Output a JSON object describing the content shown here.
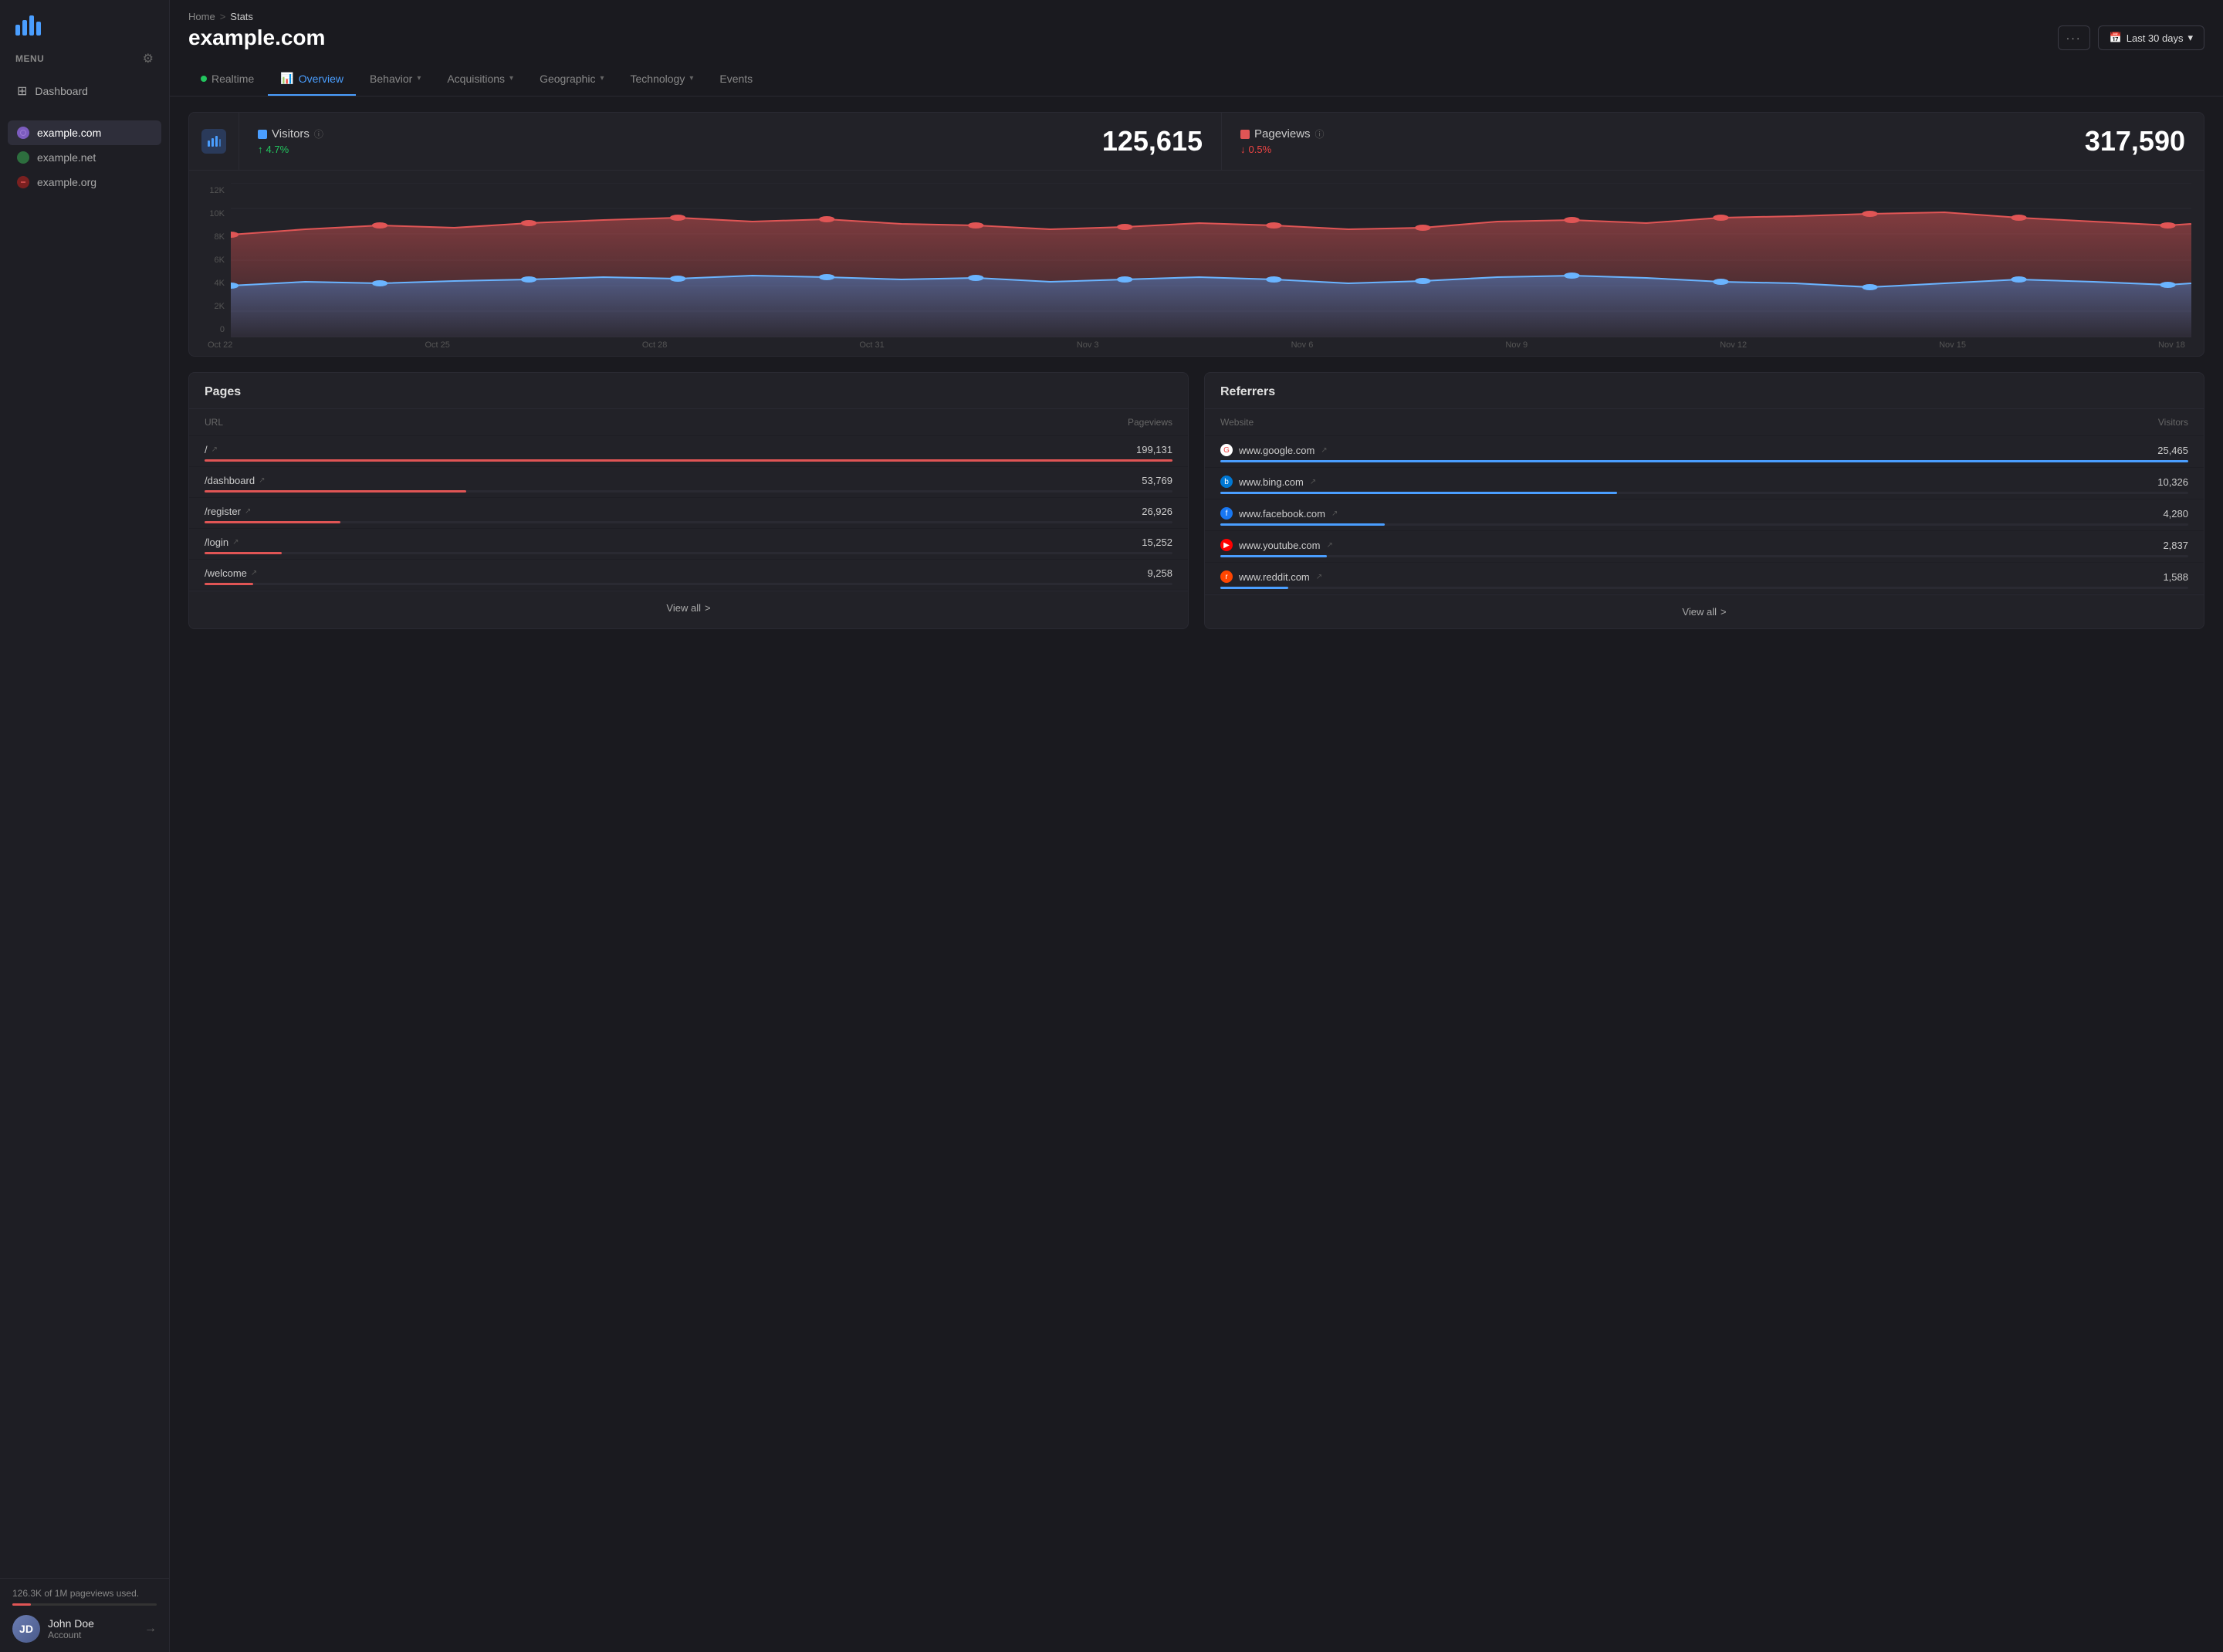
{
  "sidebar": {
    "logo_alt": "Analytics Logo",
    "menu_label": "MENU",
    "settings_icon": "⚙",
    "nav_items": [
      {
        "id": "dashboard",
        "icon": "⊞",
        "label": "Dashboard"
      }
    ],
    "sites": [
      {
        "id": "example-com",
        "label": "example.com",
        "dot_class": "dot-purple",
        "active": true
      },
      {
        "id": "example-net",
        "label": "example.net",
        "dot_class": "dot-green",
        "active": false
      },
      {
        "id": "example-org",
        "label": "example.org",
        "dot_class": "dot-red",
        "active": false
      }
    ],
    "usage_text": "126.3K of 1M pageviews used.",
    "user": {
      "name": "John Doe",
      "account": "Account",
      "initials": "JD"
    },
    "logout_icon": "→"
  },
  "header": {
    "breadcrumb_home": "Home",
    "breadcrumb_sep": ">",
    "breadcrumb_current": "Stats",
    "page_title": "example.com",
    "more_icon": "···",
    "date_icon": "📅",
    "date_label": "Last 30 days",
    "date_chevron": "▾"
  },
  "tabs": [
    {
      "id": "realtime",
      "label": "Realtime",
      "type": "dot"
    },
    {
      "id": "overview",
      "label": "Overview",
      "icon": "📊",
      "active": true
    },
    {
      "id": "behavior",
      "label": "Behavior",
      "icon": "≡",
      "chevron": "▾"
    },
    {
      "id": "acquisitions",
      "label": "Acquisitions",
      "icon": "✦",
      "chevron": "▾"
    },
    {
      "id": "geographic",
      "label": "Geographic",
      "icon": "⊞",
      "chevron": "▾"
    },
    {
      "id": "technology",
      "label": "Technology",
      "icon": "◫",
      "chevron": "▾"
    },
    {
      "id": "events",
      "label": "Events",
      "icon": "⊕"
    }
  ],
  "metrics": {
    "chart_icon": "📊",
    "visitors": {
      "label": "Visitors",
      "color": "#4a9eff",
      "change": "4.7%",
      "change_dir": "up",
      "change_icon": "↑",
      "value": "125,615"
    },
    "pageviews": {
      "label": "Pageviews",
      "color": "#e05555",
      "change": "0.5%",
      "change_dir": "down",
      "change_icon": "↓",
      "value": "317,590"
    }
  },
  "chart": {
    "y_labels": [
      "12K",
      "10K",
      "8K",
      "6K",
      "4K",
      "2K",
      "0"
    ],
    "x_labels": [
      "Oct 22",
      "Oct 25",
      "Oct 28",
      "Oct 31",
      "Nov 3",
      "Nov 6",
      "Nov 9",
      "Nov 12",
      "Nov 15",
      "Nov 18"
    ]
  },
  "pages": {
    "title": "Pages",
    "col_url": "URL",
    "col_pageviews": "Pageviews",
    "rows": [
      {
        "url": "/",
        "value": "199,131",
        "pct": 100
      },
      {
        "url": "/dashboard",
        "value": "53,769",
        "pct": 27
      },
      {
        "url": "/register",
        "value": "26,926",
        "pct": 14
      },
      {
        "url": "/login",
        "value": "15,252",
        "pct": 8
      },
      {
        "url": "/welcome",
        "value": "9,258",
        "pct": 5
      }
    ],
    "view_all": "View all",
    "view_all_arrow": ">"
  },
  "referrers": {
    "title": "Referrers",
    "col_website": "Website",
    "col_visitors": "Visitors",
    "rows": [
      {
        "site": "www.google.com",
        "value": "25,465",
        "pct": 100,
        "fav_class": "fav-google",
        "fav_text": "G"
      },
      {
        "site": "www.bing.com",
        "value": "10,326",
        "pct": 41,
        "fav_class": "fav-bing",
        "fav_text": "b"
      },
      {
        "site": "www.facebook.com",
        "value": "4,280",
        "pct": 17,
        "fav_class": "fav-facebook",
        "fav_text": "f"
      },
      {
        "site": "www.youtube.com",
        "value": "2,837",
        "pct": 11,
        "fav_class": "fav-youtube",
        "fav_text": "▶"
      },
      {
        "site": "www.reddit.com",
        "value": "1,588",
        "pct": 7,
        "fav_class": "fav-reddit",
        "fav_text": "r"
      }
    ],
    "view_all": "View all",
    "view_all_arrow": ">"
  }
}
